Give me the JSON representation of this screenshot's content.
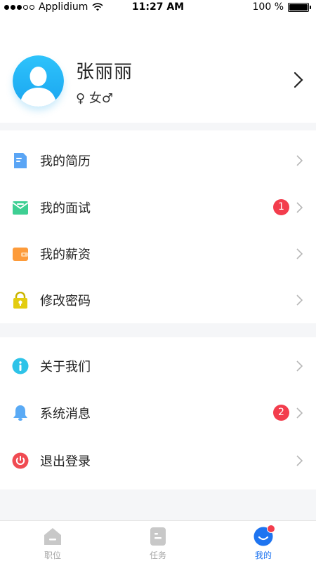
{
  "status_bar": {
    "carrier": "Applidium",
    "time": "11:27 AM",
    "battery": "100 %"
  },
  "profile": {
    "name": "张丽丽",
    "gender_text": "女",
    "avatar_color": "#27b6f5"
  },
  "menu_section_1": [
    {
      "label": "我的简历",
      "icon": "resume-icon",
      "badge": ""
    },
    {
      "label": "我的面试",
      "icon": "interview-icon",
      "badge": "1"
    },
    {
      "label": "我的薪资",
      "icon": "wallet-icon",
      "badge": ""
    },
    {
      "label": "修改密码",
      "icon": "lock-icon",
      "badge": ""
    }
  ],
  "menu_section_2": [
    {
      "label": "关于我们",
      "icon": "info-icon",
      "badge": ""
    },
    {
      "label": "系统消息",
      "icon": "bell-icon",
      "badge": "2"
    },
    {
      "label": "退出登录",
      "icon": "power-icon",
      "badge": ""
    }
  ],
  "tabbar": {
    "tabs": [
      {
        "label": "职位",
        "icon": "home-icon",
        "active": false
      },
      {
        "label": "任务",
        "icon": "task-icon",
        "active": false
      },
      {
        "label": "我的",
        "icon": "profile-tab-icon",
        "active": true
      }
    ]
  },
  "colors": {
    "accent": "#1e74f0",
    "badge": "#f33d4d",
    "background": "#f5f6f8"
  }
}
